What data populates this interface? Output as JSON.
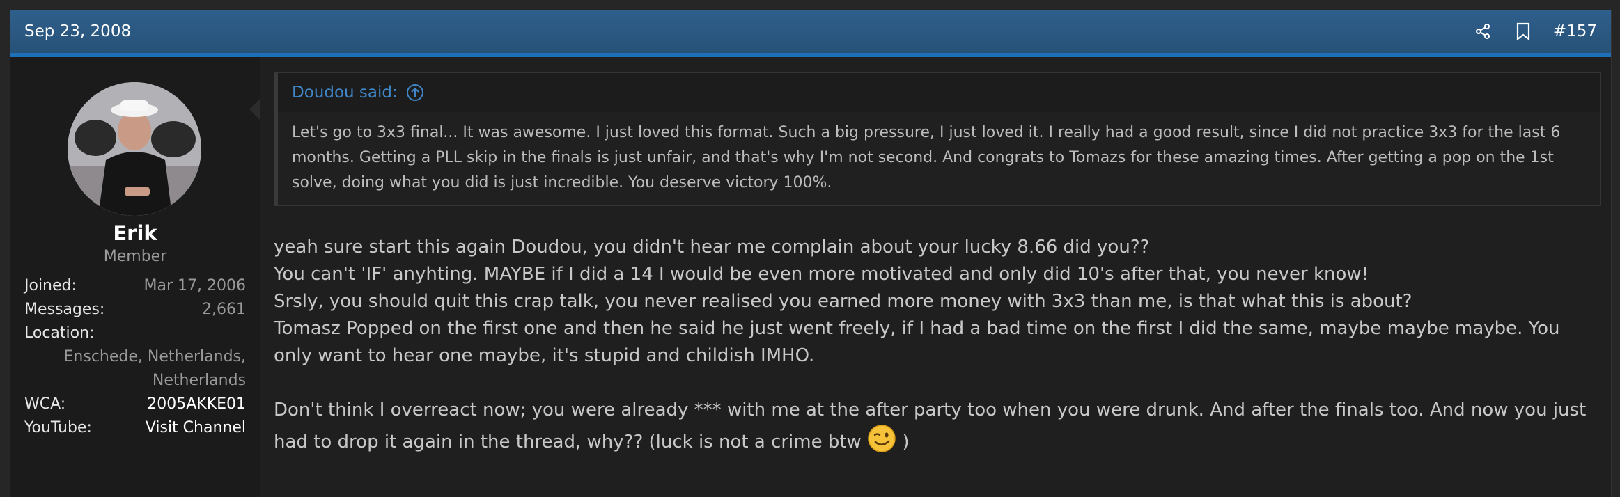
{
  "post": {
    "date": "Sep 23, 2008",
    "number": "#157",
    "icons": {
      "share": "share-icon",
      "bookmark": "bookmark-icon"
    }
  },
  "user": {
    "name": "Erik",
    "title": "Member",
    "stats": [
      {
        "label": "Joined:",
        "value": "Mar 17, 2006"
      },
      {
        "label": "Messages:",
        "value": "2,661"
      },
      {
        "label": "Location:",
        "value": "Enschede, Netherlands, Netherlands"
      },
      {
        "label": "WCA:",
        "value": "2005AKKE01"
      },
      {
        "label": "YouTube:",
        "value": "Visit Channel"
      }
    ],
    "location_line1": "Enschede, Netherlands,",
    "location_line2": "Netherlands"
  },
  "quote": {
    "author": "Doudou said:",
    "text": "Let's go to 3x3 final... It was awesome. I just loved this format. Such a big pressure, I just loved it. I really had a good result, since I did not practice 3x3 for the last 6 months. Getting a PLL skip in the finals is just unfair, and that's why I'm not second. And congrats to Tomazs for these amazing times. After getting a pop on the 1st solve, doing what you did is just incredible. You deserve victory 100%."
  },
  "message": {
    "lines": [
      "yeah sure start this again Doudou, you didn't hear me complain about your lucky 8.66 did you??",
      "You can't 'IF' anyhting. MAYBE if I did a 14 I would be even more motivated and only did 10's after that, you never know!",
      "Srsly, you should quit this crap talk, you never realised you earned more money with 3x3 than me, is that what this is about?",
      "Tomasz Popped on the first one and then he said he just went freely, if I had a bad time on the first I did the same, maybe maybe maybe. You only want to hear one maybe, it's stupid and childish IMHO."
    ],
    "last_paragraph": "Don't think I overreact now; you were already *** with me at the after party too when you were drunk. And after the finals too. And now you just had to drop it again in the thread, why?? (luck is not a crime btw",
    "last_paragraph_end": ")"
  },
  "colors": {
    "header": "#2f5f8c",
    "accent": "#1d6fb8",
    "link": "#3f87c9"
  }
}
